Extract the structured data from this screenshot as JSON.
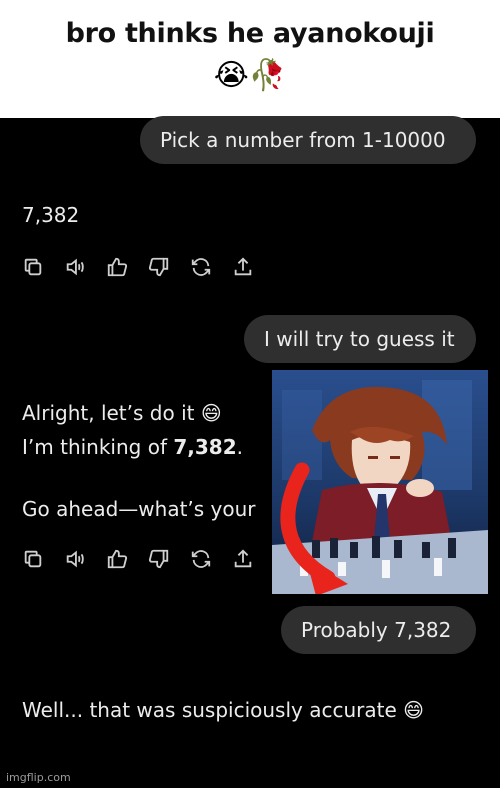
{
  "caption": {
    "title": "bro thinks he ayanokouji",
    "emoji": "😭🥀"
  },
  "messages": {
    "user_1": "Pick a number from 1-10000",
    "ai_1": "7,382",
    "user_2": "I will try to guess it",
    "ai_2_line1": "Alright, let’s do it 😄",
    "ai_2_line2_prefix": "I’m thinking of ",
    "ai_2_line2_number": "7,382",
    "ai_2_line2_suffix": ".",
    "ai_2_line3": "Go ahead—what’s your",
    "user_3": "Probably 7,382",
    "ai_3": "Well... that was suspiciously accurate 😄"
  },
  "toolbar_icons": [
    "copy-icon",
    "speaker-icon",
    "thumbs-up-icon",
    "thumbs-down-icon",
    "regenerate-icon",
    "share-icon"
  ],
  "watermark": "imgflip.com",
  "colors": {
    "background": "#000000",
    "bubble": "#2f2f2f",
    "text": "#ececec",
    "arrow": "#e8241c"
  }
}
